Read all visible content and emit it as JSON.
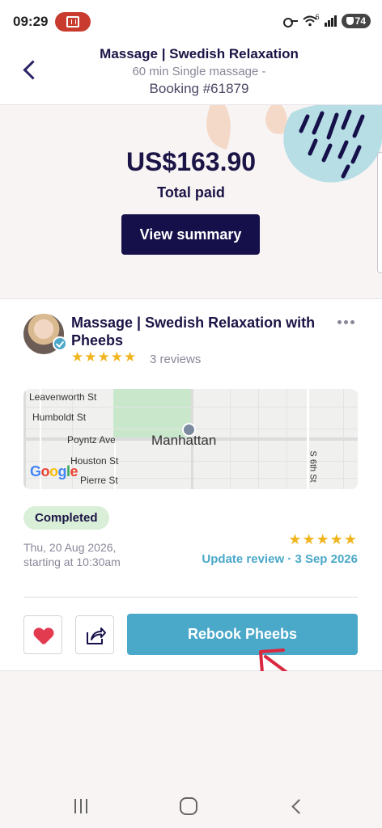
{
  "status_bar": {
    "time": "09:29",
    "battery": "74",
    "network_label": "6"
  },
  "header": {
    "title": "Massage | Swedish Relaxation",
    "subtitle": "60 min Single massage -",
    "booking": "Booking #61879"
  },
  "payment": {
    "amount": "US$163.90",
    "label": "Total paid",
    "view_summary_label": "View summary"
  },
  "provider": {
    "name": "Massage  |  Swedish Relaxation with Pheebs",
    "rating_stars": 5,
    "stars_text": "★★★★★",
    "reviews_text": "3 reviews"
  },
  "map": {
    "labels": {
      "leavenworth": "Leavenworth St",
      "humboldt": "Humboldt St",
      "poyntz": "Poyntz Ave",
      "manhattan": "Manhattan",
      "houston": "Houston St",
      "pierre": "Pierre St",
      "sixth": "S 6th St"
    },
    "google": [
      "G",
      "o",
      "o",
      "g",
      "l",
      "e"
    ]
  },
  "booking_status": {
    "badge": "Completed",
    "date_line1": "Thu, 20 Aug 2026,",
    "date_line2": "starting at 10:30am",
    "review_stars": 5,
    "review_stars_text": "★★★★★",
    "update_review": "Update review · 3 Sep 2026"
  },
  "actions": {
    "rebook_label": "Rebook Pheebs",
    "favorite_icon": "heart-icon",
    "share_icon": "share-icon"
  },
  "colors": {
    "primary_dark": "#15104a",
    "accent_teal": "#4aa8c8",
    "completed_bg": "#d9efd7",
    "star": "#f0b51e",
    "heart": "#e23a4f",
    "annotation_arrow": "#d9283f"
  }
}
